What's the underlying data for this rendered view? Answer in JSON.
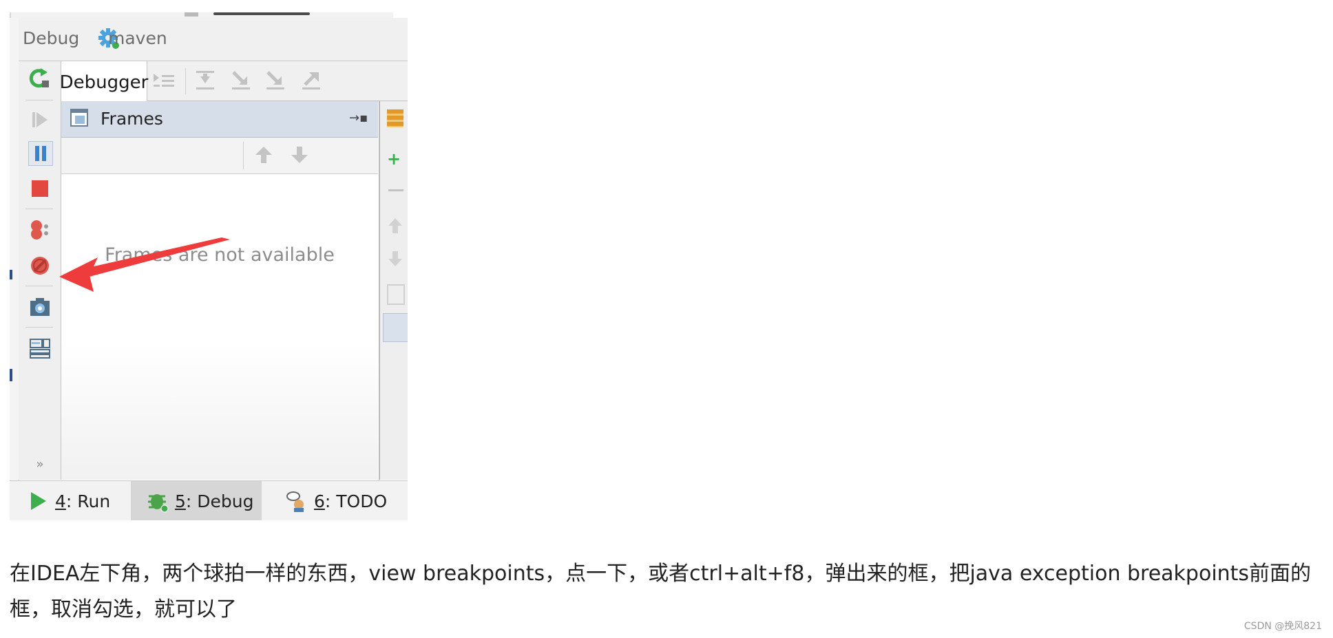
{
  "debug_header": {
    "title": "Debug",
    "config": "maven"
  },
  "tabs": {
    "debugger": "Debugger"
  },
  "frames": {
    "title": "Frames",
    "empty_message": "Frames are not available"
  },
  "bottom_tabs": [
    {
      "number": "4",
      "label": ": Run",
      "icon": "run-icon"
    },
    {
      "number": "5",
      "label": ": Debug",
      "icon": "bug-icon",
      "active": true
    },
    {
      "number": "6",
      "label": ": TODO",
      "icon": "todo-icon"
    }
  ],
  "toolbar_left": [
    "rerun-icon",
    "resume-icon",
    "pause-icon",
    "stop-icon",
    "view-breakpoints-icon",
    "mute-breakpoints-icon",
    "camera-icon",
    "layout-icon",
    "more-icon"
  ],
  "toolbar_top": [
    "show-execution-point-icon",
    "step-over-icon",
    "step-into-icon",
    "force-step-into-icon",
    "step-out-icon"
  ],
  "colors": {
    "accent_green": "#3cae4b",
    "stop_red": "#e2483d",
    "pause_blue": "#3a83c8",
    "arrow_red": "#ee3b3b"
  },
  "article": {
    "text": "在IDEA左下角，两个球拍一样的东西，view breakpoints，点一下，或者ctrl+alt+f8，弹出来的框，把java exception breakpoints前面的框，取消勾选，就可以了"
  },
  "watermark": "CSDN @挽风821"
}
